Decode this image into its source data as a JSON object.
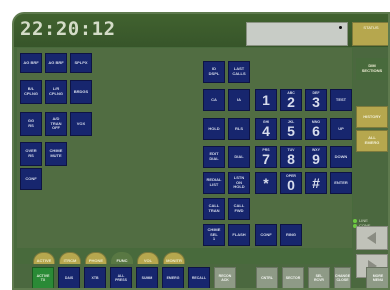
{
  "header": {
    "clock": "22:20:12",
    "status_label": "STATUS"
  },
  "keys": {
    "ag_brf_1": "AG BRF",
    "ag_brf_2": "AG BRF",
    "splpx": "SPLPX",
    "bl_cplng": "B/L\nCPLNG",
    "lr_cplng": "L/R\nCPLNG",
    "bridge": "BRDGS",
    "gg_rs": "GG\nRS",
    "ad_tran_off": "A/D\nTRAN\nOFF",
    "vox": "VOX",
    "over_rs": "OVER\nRS",
    "chime_mute": "CHIME\nMUTE",
    "conf": "CONF",
    "id_displ": "ID\nDSPL",
    "last_calls": "LAST\nCALLS",
    "ca": "CA",
    "ia": "IA",
    "hold": "HOLD",
    "rls": "RLS",
    "edit_dial": "EDIT\nDIAL",
    "dial": "DIAL",
    "redial_list": "REDIAL\nLIST",
    "lstn_on_hold": "LSTN\nON\nHOLD",
    "call_tran": "CALL\nTRAN",
    "call_fwd": "CALL\nFWD",
    "chime_sel": "CHIME\nSEL\n1",
    "flash": "FLASH",
    "conf2": "CONF",
    "ring": "RING",
    "test": "TEST",
    "up": "UP",
    "down": "DOWN",
    "enter": "ENTER",
    "keypad": [
      {
        "digit": "1",
        "letters": ""
      },
      {
        "digit": "2",
        "letters": "ABC"
      },
      {
        "digit": "3",
        "letters": "DEF"
      },
      {
        "digit": "4",
        "letters": "GHI"
      },
      {
        "digit": "5",
        "letters": "JKL"
      },
      {
        "digit": "6",
        "letters": "MNO"
      },
      {
        "digit": "7",
        "letters": "PRS"
      },
      {
        "digit": "8",
        "letters": "TUV"
      },
      {
        "digit": "9",
        "letters": "WXY"
      },
      {
        "digit": "*",
        "letters": ""
      },
      {
        "digit": "0",
        "letters": "OPER"
      },
      {
        "digit": "#",
        "letters": ""
      }
    ]
  },
  "tabs": [
    {
      "label": "ACTIVE",
      "number": "1",
      "active": false
    },
    {
      "label": "ITRCM",
      "number": "2",
      "active": false
    },
    {
      "label": "PHONE",
      "number": "3",
      "active": false
    },
    {
      "label": "FUNC",
      "number": "4",
      "active": true
    },
    {
      "label": "VOL",
      "number": "5",
      "active": false
    },
    {
      "label": "MONITR",
      "number": "6",
      "active": false
    }
  ],
  "bottom_buttons": [
    {
      "label": "ACTIVE\nTX",
      "style": "green"
    },
    {
      "label": "DAIS",
      "style": "blue"
    },
    {
      "label": "XTB",
      "style": "blue"
    },
    {
      "label": "ALL\nPRESS",
      "style": "blue"
    },
    {
      "label": "SUMM",
      "style": "blue"
    },
    {
      "label": "EMERG",
      "style": "blue"
    },
    {
      "label": "RECALL",
      "style": "blue"
    },
    {
      "label": "RECON\nACK",
      "style": "gray"
    },
    {
      "label": "CNTRL",
      "style": "gray"
    },
    {
      "label": "SECTOR",
      "style": "gray"
    },
    {
      "label": "SEL\nRCVR",
      "style": "gray"
    },
    {
      "label": "CHANGE\nCLOSE",
      "style": "gray"
    },
    {
      "label": "MORE\nMENU",
      "style": "gray"
    }
  ],
  "side_buttons": {
    "dim_sections": "DIM\nSECTIONS",
    "history": "HISTORY",
    "all_emerg": "ALL\nEMERG",
    "line_label": "LINE",
    "conf_label": "CONF"
  },
  "colors": {
    "panel": "#486a3c",
    "key": "#17266e",
    "tab": "#b6a74e",
    "active_tx": "#2a8a36"
  }
}
